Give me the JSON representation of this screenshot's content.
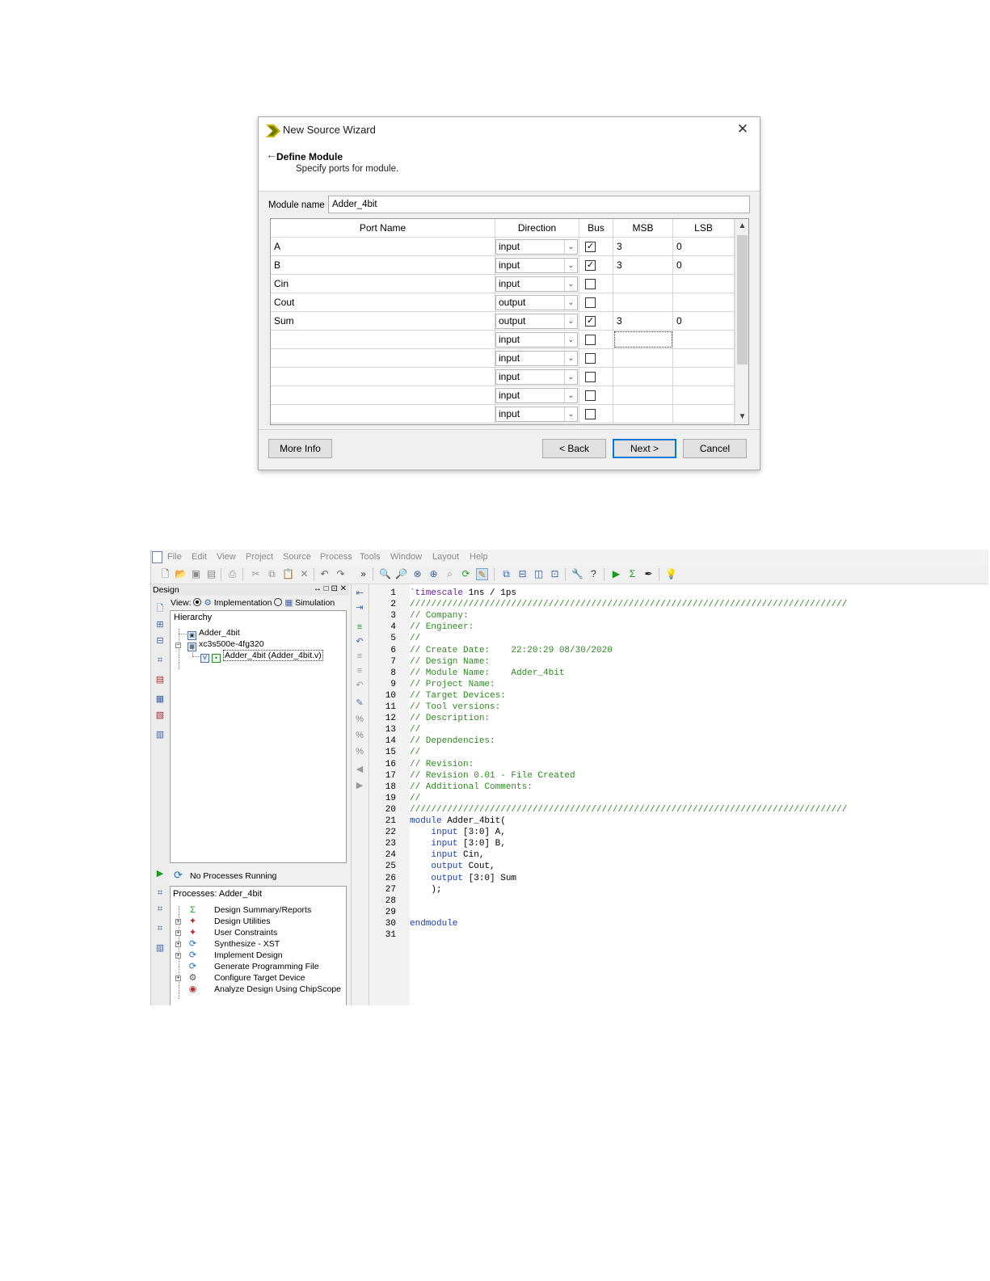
{
  "wizard": {
    "title": "New Source Wizard",
    "close_glyph": "✕",
    "back_glyph": "←",
    "heading": "Define Module",
    "subheading": "Specify ports for module.",
    "module_name_label": "Module name",
    "module_name_value": "Adder_4bit",
    "columns": [
      "Port Name",
      "Direction",
      "Bus",
      "MSB",
      "LSB"
    ],
    "ports": [
      {
        "name": "A",
        "direction": "input",
        "bus": true,
        "msb": "3",
        "lsb": "0"
      },
      {
        "name": "B",
        "direction": "input",
        "bus": true,
        "msb": "3",
        "lsb": "0"
      },
      {
        "name": "Cin",
        "direction": "input",
        "bus": false,
        "msb": "",
        "lsb": ""
      },
      {
        "name": "Cout",
        "direction": "output",
        "bus": false,
        "msb": "",
        "lsb": ""
      },
      {
        "name": "Sum",
        "direction": "output",
        "bus": true,
        "msb": "3",
        "lsb": "0"
      },
      {
        "name": "",
        "direction": "input",
        "bus": false,
        "msb": "",
        "lsb": ""
      },
      {
        "name": "",
        "direction": "input",
        "bus": false,
        "msb": "",
        "lsb": ""
      },
      {
        "name": "",
        "direction": "input",
        "bus": false,
        "msb": "",
        "lsb": ""
      },
      {
        "name": "",
        "direction": "input",
        "bus": false,
        "msb": "",
        "lsb": ""
      },
      {
        "name": "",
        "direction": "input",
        "bus": false,
        "msb": "",
        "lsb": ""
      }
    ],
    "buttons": {
      "more_info": "More Info",
      "back": "< Back",
      "next": "Next >",
      "cancel": "Cancel"
    }
  },
  "ise": {
    "menu": [
      "File",
      "Edit",
      "View",
      "Project",
      "Source",
      "Process",
      "Tools",
      "Window",
      "Layout",
      "Help"
    ],
    "design_panel": {
      "title": "Design",
      "title_controls": "↔ □ ⊡ ✕",
      "view_label": "View:",
      "view_implementation": "Implementation",
      "view_simulation": "Simulation",
      "hierarchy_label": "Hierarchy",
      "tree": [
        "Adder_4bit",
        "xc3s500e-4fg320",
        "Adder_4bit (Adder_4bit.v)"
      ]
    },
    "process_panel": {
      "status": "No Processes Running",
      "label": "Processes: Adder_4bit",
      "items": [
        "Design Summary/Reports",
        "Design Utilities",
        "User Constraints",
        "Synthesize - XST",
        "Implement Design",
        "Generate Programming File",
        "Configure Target Device",
        "Analyze Design Using ChipScope"
      ]
    },
    "editor": {
      "lines": [
        {
          "n": "1",
          "segs": [
            [
              "kw",
              "`timescale"
            ],
            [
              "plain",
              " 1ns / 1ps"
            ]
          ]
        },
        {
          "n": "2",
          "segs": [
            [
              "comment",
              "//////////////////////////////////////////////////////////////////////////////////"
            ]
          ]
        },
        {
          "n": "3",
          "segs": [
            [
              "comment",
              "// Company:"
            ]
          ]
        },
        {
          "n": "4",
          "segs": [
            [
              "comment",
              "// Engineer:"
            ]
          ]
        },
        {
          "n": "5",
          "segs": [
            [
              "comment",
              "//"
            ]
          ]
        },
        {
          "n": "6",
          "segs": [
            [
              "comment",
              "// Create Date:    22:20:29 08/30/2020"
            ]
          ]
        },
        {
          "n": "7",
          "segs": [
            [
              "comment",
              "// Design Name:"
            ]
          ]
        },
        {
          "n": "8",
          "segs": [
            [
              "comment",
              "// Module Name:    Adder_4bit"
            ]
          ]
        },
        {
          "n": "9",
          "segs": [
            [
              "comment",
              "// Project Name:"
            ]
          ]
        },
        {
          "n": "10",
          "segs": [
            [
              "comment",
              "// Target Devices:"
            ]
          ]
        },
        {
          "n": "11",
          "segs": [
            [
              "comment",
              "// Tool versions:"
            ]
          ]
        },
        {
          "n": "12",
          "segs": [
            [
              "comment",
              "// Description:"
            ]
          ]
        },
        {
          "n": "13",
          "segs": [
            [
              "comment",
              "//"
            ]
          ]
        },
        {
          "n": "14",
          "segs": [
            [
              "comment",
              "// Dependencies:"
            ]
          ]
        },
        {
          "n": "15",
          "segs": [
            [
              "comment",
              "//"
            ]
          ]
        },
        {
          "n": "16",
          "segs": [
            [
              "comment",
              "// Revision:"
            ]
          ]
        },
        {
          "n": "17",
          "segs": [
            [
              "comment",
              "// Revision 0.01 - File Created"
            ]
          ]
        },
        {
          "n": "18",
          "segs": [
            [
              "comment",
              "// Additional Comments:"
            ]
          ]
        },
        {
          "n": "19",
          "segs": [
            [
              "comment",
              "//"
            ]
          ]
        },
        {
          "n": "20",
          "segs": [
            [
              "comment",
              "//////////////////////////////////////////////////////////////////////////////////"
            ]
          ]
        },
        {
          "n": "21",
          "segs": [
            [
              "blue",
              "module"
            ],
            [
              "plain",
              " Adder_4bit("
            ]
          ]
        },
        {
          "n": "22",
          "segs": [
            [
              "plain",
              "    "
            ],
            [
              "blue",
              "input"
            ],
            [
              "plain",
              " [3:0] A,"
            ]
          ]
        },
        {
          "n": "23",
          "segs": [
            [
              "plain",
              "    "
            ],
            [
              "blue",
              "input"
            ],
            [
              "plain",
              " [3:0] B,"
            ]
          ]
        },
        {
          "n": "24",
          "segs": [
            [
              "plain",
              "    "
            ],
            [
              "blue",
              "input"
            ],
            [
              "plain",
              " Cin,"
            ]
          ]
        },
        {
          "n": "25",
          "segs": [
            [
              "plain",
              "    "
            ],
            [
              "blue",
              "output"
            ],
            [
              "plain",
              " Cout,"
            ]
          ]
        },
        {
          "n": "26",
          "segs": [
            [
              "plain",
              "    "
            ],
            [
              "blue",
              "output"
            ],
            [
              "plain",
              " [3:0] Sum"
            ]
          ]
        },
        {
          "n": "27",
          "segs": [
            [
              "plain",
              "    );"
            ]
          ]
        },
        {
          "n": "28",
          "segs": []
        },
        {
          "n": "29",
          "segs": []
        },
        {
          "n": "30",
          "segs": [
            [
              "blue",
              "endmodule"
            ]
          ]
        },
        {
          "n": "31",
          "segs": []
        }
      ]
    }
  }
}
